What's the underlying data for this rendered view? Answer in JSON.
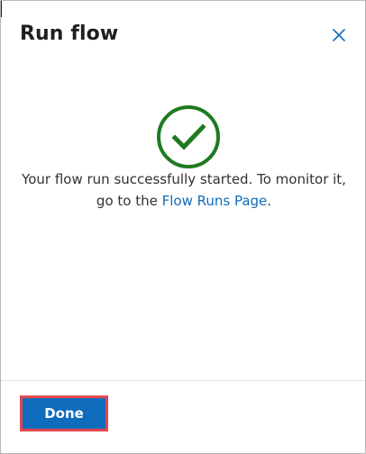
{
  "dialog": {
    "title": "Run flow",
    "message_prefix": "Your flow run successfully started. To monitor it, go to the ",
    "message_link": "Flow Runs Page",
    "message_suffix": ".",
    "done_label": "Done"
  },
  "icons": {
    "close": "close-icon",
    "success": "check-circle-icon"
  },
  "colors": {
    "accent": "#0f6cbd",
    "success": "#1f7a1f",
    "focus_outline": "#e5474f",
    "border": "#b8b8b8",
    "divider": "#e1dfdd",
    "text": "#323130"
  }
}
